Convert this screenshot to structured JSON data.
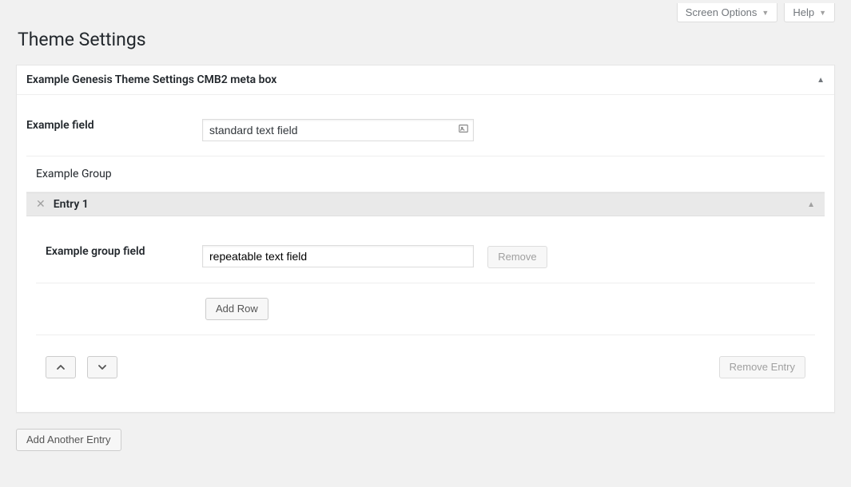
{
  "topBar": {
    "screenOptions": "Screen Options",
    "help": "Help"
  },
  "page": {
    "title": "Theme Settings"
  },
  "metabox": {
    "title": "Example Genesis Theme Settings CMB2 meta box"
  },
  "fields": {
    "exampleField": {
      "label": "Example field",
      "value": "standard text field"
    },
    "groupTitle": "Example Group",
    "entry": {
      "title": "Entry 1",
      "groupField": {
        "label": "Example group field",
        "value": "repeatable text field"
      }
    }
  },
  "buttons": {
    "remove": "Remove",
    "addRow": "Add Row",
    "removeEntry": "Remove Entry",
    "addAnotherEntry": "Add Another Entry"
  }
}
